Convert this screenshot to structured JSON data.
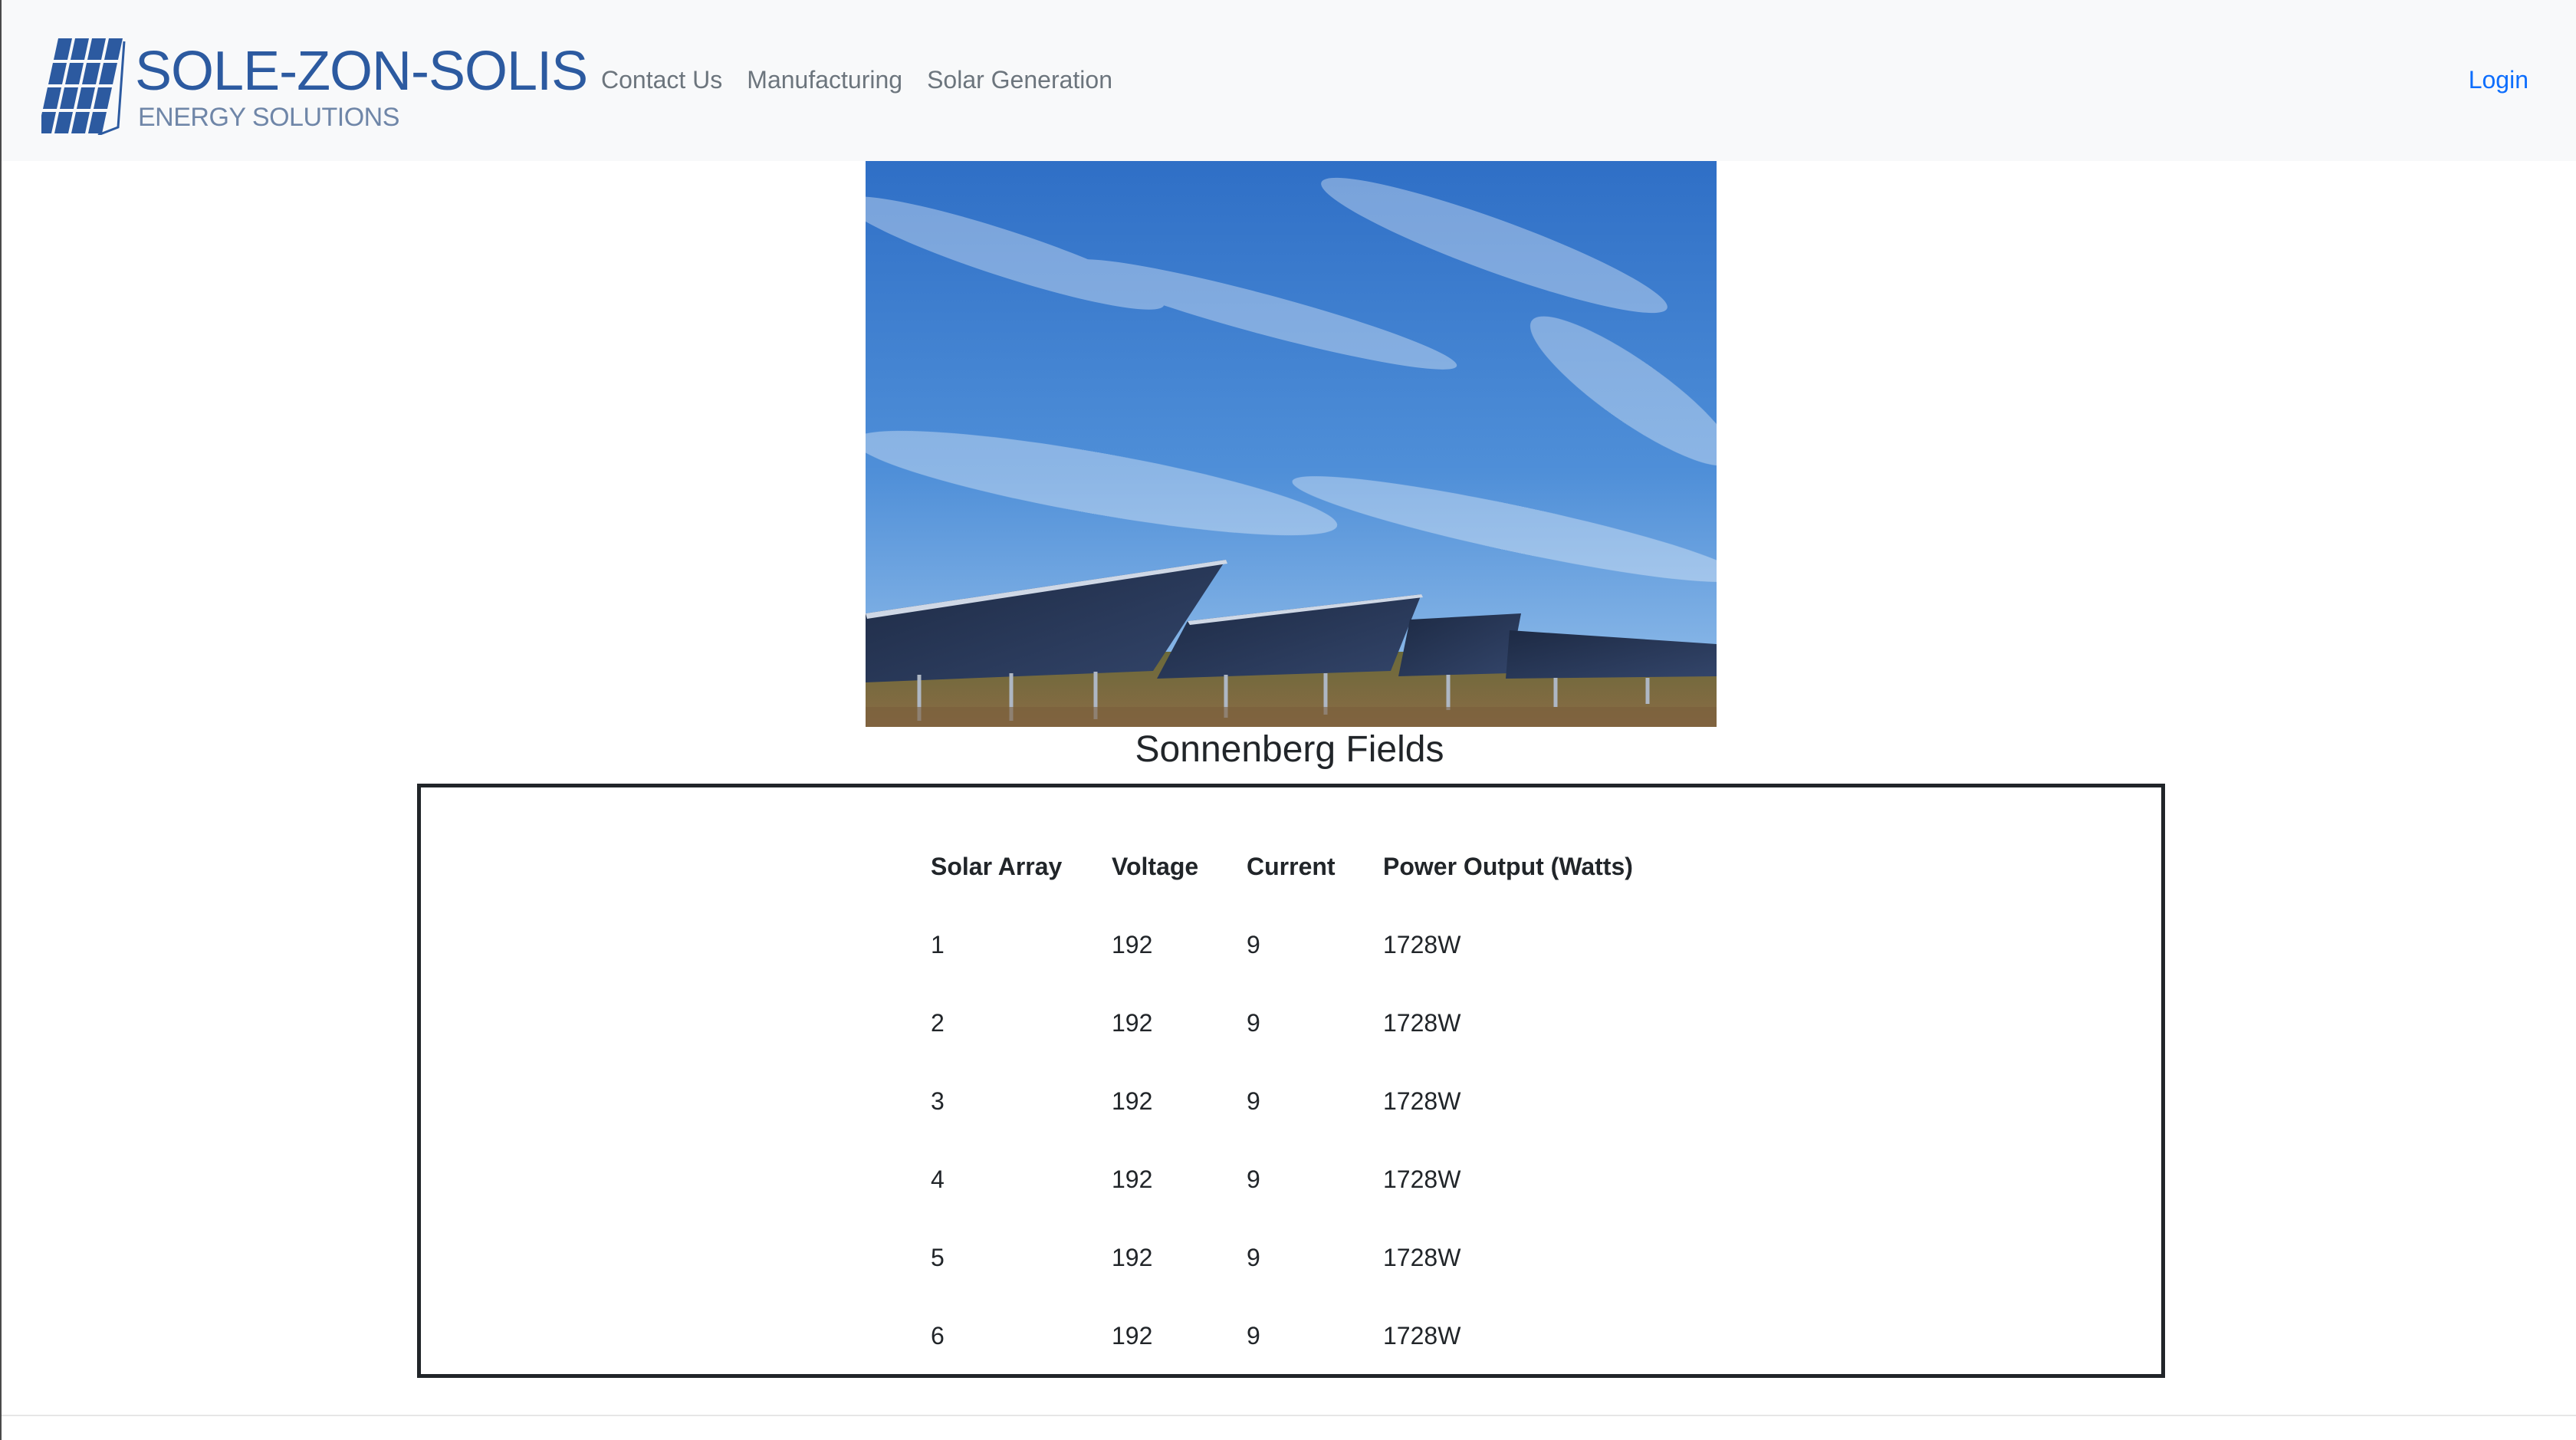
{
  "navbar": {
    "brand_name": "SOLE-ZON-SOLIS",
    "brand_sub": "ENERGY SOLUTIONS",
    "links": [
      "Contact Us",
      "Manufacturing",
      "Solar Generation"
    ],
    "login": "Login"
  },
  "colors": {
    "brand_blue": "#2c5aa0",
    "link_blue": "#0d6efd",
    "nav_text": "#6c757d",
    "navbar_bg": "#f8f9fa"
  },
  "site": {
    "title": "Sonnenberg Fields"
  },
  "table": {
    "headers": [
      "Solar Array",
      "Voltage",
      "Current",
      "Power Output (Watts)"
    ],
    "rows": [
      [
        "1",
        "192",
        "9",
        "1728W"
      ],
      [
        "2",
        "192",
        "9",
        "1728W"
      ],
      [
        "3",
        "192",
        "9",
        "1728W"
      ],
      [
        "4",
        "192",
        "9",
        "1728W"
      ],
      [
        "5",
        "192",
        "9",
        "1728W"
      ],
      [
        "6",
        "192",
        "9",
        "1728W"
      ]
    ]
  }
}
